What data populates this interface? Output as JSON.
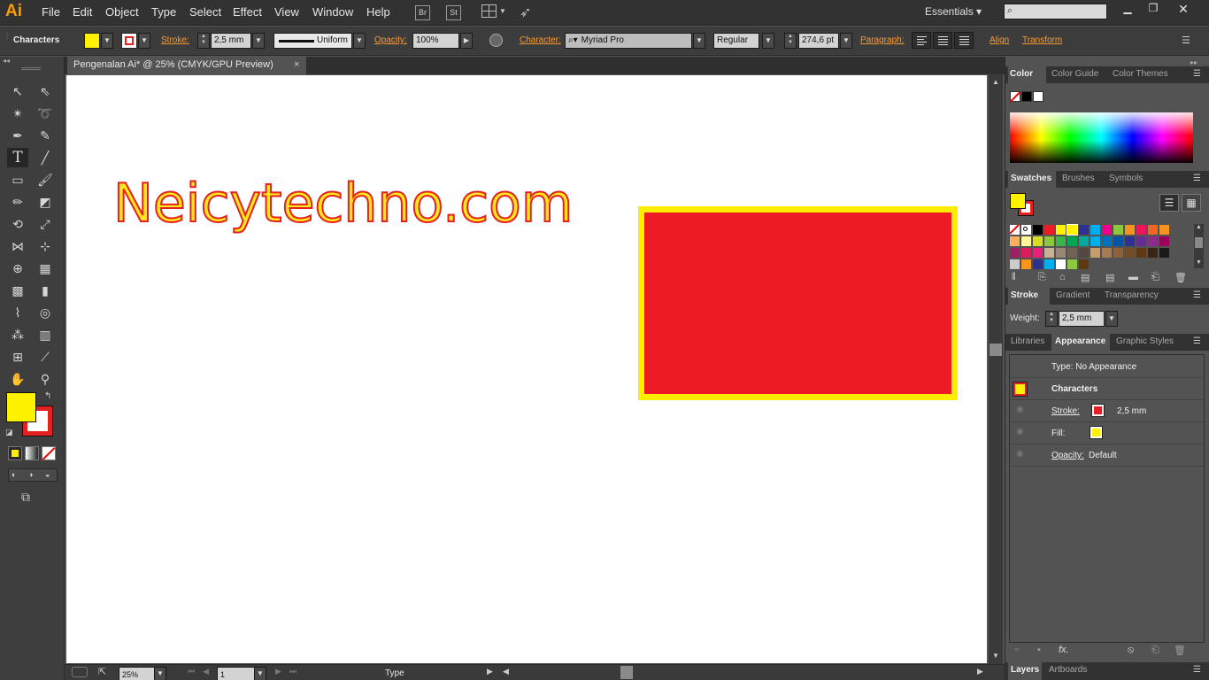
{
  "app": {
    "logo": "Ai"
  },
  "menu": [
    "File",
    "Edit",
    "Object",
    "Type",
    "Select",
    "Effect",
    "View",
    "Window",
    "Help"
  ],
  "menu_buttons": {
    "bridge": "Br",
    "stock": "St"
  },
  "workspace": "Essentials",
  "control": {
    "selection_label": "Characters",
    "stroke_label": "Stroke:",
    "stroke_value": "2,5 mm",
    "profile": "Uniform",
    "opacity_label": "Opacity:",
    "opacity_value": "100%",
    "character_label": "Character:",
    "font_family": "Myriad Pro",
    "font_style": "Regular",
    "font_size": "274,6 pt",
    "paragraph_label": "Paragraph:",
    "align_label": "Align",
    "transform_label": "Transform"
  },
  "document": {
    "tab_title": "Pengenalan Ai* @ 25% (CMYK/GPU Preview)",
    "close": "×"
  },
  "artwork": {
    "text": "Neicytechno.com",
    "fill_color": "#ffe81a",
    "stroke_color": "#e52020",
    "rect_fill": "#ed1c24",
    "rect_stroke": "#ffed00"
  },
  "status": {
    "zoom": "25%",
    "page": "1",
    "tool_name": "Type"
  },
  "panels": {
    "color_tabs": [
      "Color",
      "Color Guide",
      "Color Themes"
    ],
    "swatch_tabs": [
      "Swatches",
      "Brushes",
      "Symbols"
    ],
    "stroke_tabs": [
      "Stroke",
      "Gradient",
      "Transparency"
    ],
    "weight_label": "Weight:",
    "weight_value": "2,5 mm",
    "appearance_tabs": [
      "Libraries",
      "Appearance",
      "Graphic Styles"
    ],
    "appearance": {
      "type": "Type: No Appearance",
      "characters": "Characters",
      "stroke_label": "Stroke:",
      "stroke_value": "2,5 mm",
      "fill_label": "Fill:",
      "opacity_label": "Opacity:",
      "opacity_value": "Default",
      "fx": "fx."
    },
    "bottom_tabs": [
      "Layers",
      "Artboards"
    ]
  }
}
